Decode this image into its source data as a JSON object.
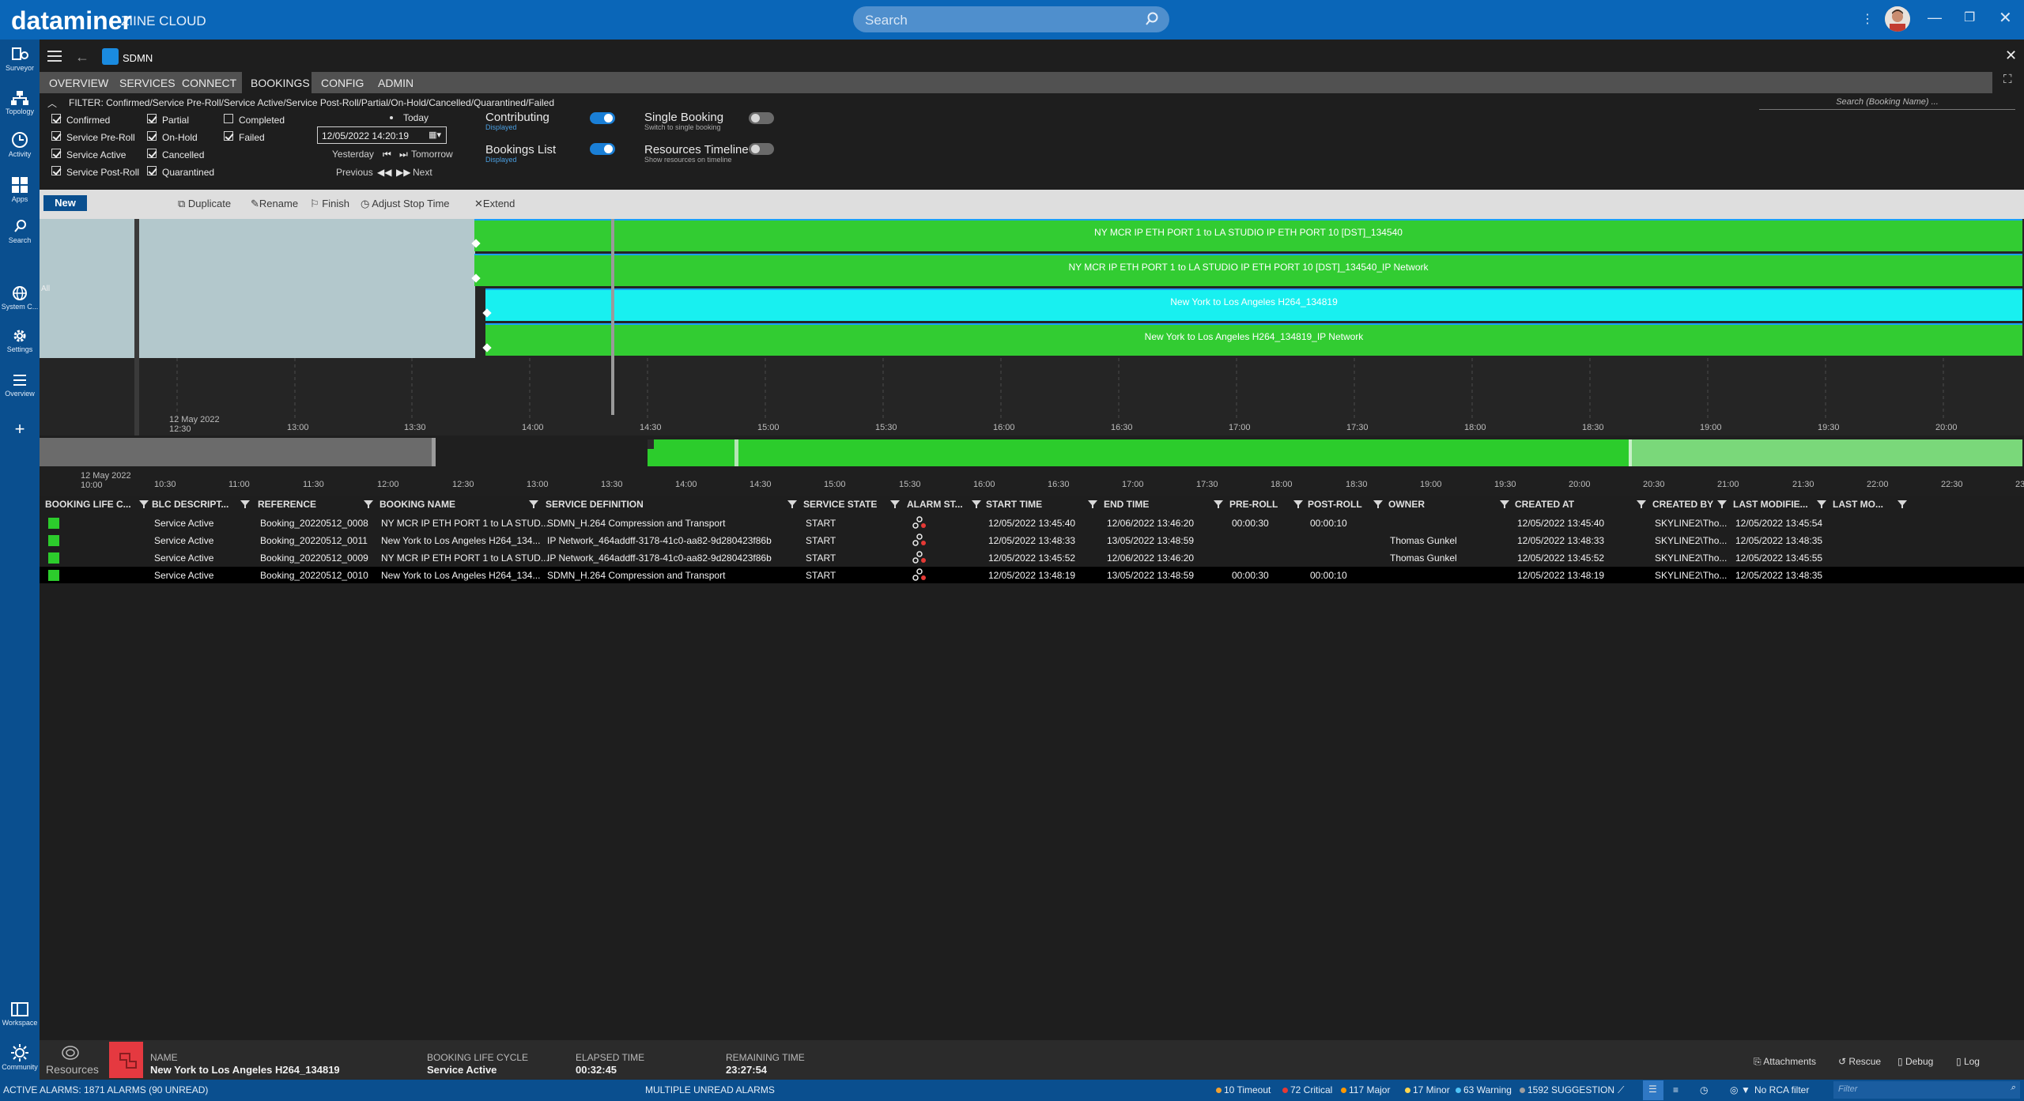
{
  "app": {
    "brand": "dataminer",
    "cluster": "ZIINE CLOUD",
    "search_placeholder": "Search"
  },
  "nav": [
    {
      "label": "Surveyor",
      "icon": "surveyor-icon"
    },
    {
      "label": "Topology",
      "icon": "topology-icon"
    },
    {
      "label": "Activity",
      "icon": "activity-icon"
    },
    {
      "label": "Apps",
      "icon": "apps-icon"
    },
    {
      "label": "Search",
      "icon": "search-icon"
    },
    {
      "label": "System C...",
      "icon": "globe-icon"
    },
    {
      "label": "Settings",
      "icon": "gear-icon"
    },
    {
      "label": "Overview",
      "icon": "list-icon"
    },
    {
      "label": "Workspace",
      "icon": "workspace-icon"
    },
    {
      "label": "Community",
      "icon": "community-icon"
    }
  ],
  "card": {
    "title": "SDMN"
  },
  "tabs": [
    "OVERVIEW",
    "SERVICES",
    "CONNECT",
    "BOOKINGS",
    "CONFIG",
    "ADMIN"
  ],
  "active_tab": "BOOKINGS",
  "filter": {
    "text": "FILTER: Confirmed/Service Pre-Roll/Service Active/Service Post-Roll/Partial/On-Hold/Cancelled/Quarantined/Failed",
    "search_placeholder": "Search (Booking Name) ...",
    "checkboxes": [
      {
        "label": "Confirmed",
        "checked": true
      },
      {
        "label": "Service Pre-Roll",
        "checked": true
      },
      {
        "label": "Service Active",
        "checked": true
      },
      {
        "label": "Service Post-Roll",
        "checked": true
      },
      {
        "label": "Partial",
        "checked": true
      },
      {
        "label": "On-Hold",
        "checked": true
      },
      {
        "label": "Cancelled",
        "checked": true
      },
      {
        "label": "Quarantined",
        "checked": true
      },
      {
        "label": "Completed",
        "checked": false
      },
      {
        "label": "Failed",
        "checked": true
      }
    ],
    "today": "Today",
    "date": "12/05/2022 14:20:19",
    "yesterday": "Yesterday",
    "tomorrow": "Tomorrow",
    "previous": "Previous",
    "next": "Next",
    "toggles": [
      {
        "label": "Contributing",
        "sub": "Displayed",
        "on": true
      },
      {
        "label": "Bookings List",
        "sub": "Displayed",
        "on": true
      },
      {
        "label": "Single Booking",
        "sub": "Switch to single booking",
        "on": false
      },
      {
        "label": "Resources Timeline",
        "sub": "Show resources on timeline",
        "on": false
      }
    ]
  },
  "actions": {
    "new": "New",
    "duplicate": "Duplicate",
    "rename": "Rename",
    "finish": "Finish",
    "adjust": "Adjust Stop Time",
    "extend": "Extend"
  },
  "timeline": {
    "all_label": "All",
    "bars": [
      {
        "label": "NY MCR IP ETH PORT 1 to LA STUDIO  IP ETH PORT 10 [DST]_134540",
        "color": "#32cc32"
      },
      {
        "label": "NY MCR IP ETH PORT 1 to LA STUDIO  IP ETH PORT 10 [DST]_134540_IP Network",
        "color": "#32cc32"
      },
      {
        "label": "New York to Los Angeles H264_134819",
        "color": "#18f0f0"
      },
      {
        "label": "New York to Los Angeles H264_134819_IP Network",
        "color": "#32cc32"
      }
    ],
    "date_label": "12 May 2022",
    "first_tick": "12:30",
    "ticks": [
      "13:00",
      "13:30",
      "14:00",
      "14:30",
      "15:00",
      "15:30",
      "16:00",
      "16:30",
      "17:00",
      "17:30",
      "18:00",
      "18:30",
      "19:00",
      "19:30",
      "20:00"
    ],
    "overview_date": "12 May 2022",
    "overview_first": "10:00",
    "overview_ticks": [
      "10:30",
      "11:00",
      "11:30",
      "12:00",
      "12:30",
      "13:00",
      "13:30",
      "14:00",
      "14:30",
      "15:00",
      "15:30",
      "16:00",
      "16:30",
      "17:00",
      "17:30",
      "18:00",
      "18:30",
      "19:00",
      "19:30",
      "20:00",
      "20:30",
      "21:00",
      "21:30",
      "22:00",
      "22:30",
      "23"
    ]
  },
  "table": {
    "columns": [
      "BOOKING LIFE C...",
      "BLC DESCRIPT...",
      "REFERENCE",
      "BOOKING NAME",
      "SERVICE DEFINITION",
      "SERVICE STATE",
      "ALARM ST...",
      "START TIME",
      "END TIME",
      "PRE-ROLL",
      "POST-ROLL",
      "OWNER",
      "CREATED AT",
      "CREATED BY",
      "LAST MODIFIE...",
      "LAST MO..."
    ],
    "rows": [
      {
        "blc": "Service Active",
        "ref": "Booking_20220512_0008",
        "name": "NY MCR IP ETH PORT 1 to LA STUD...",
        "svc": "SDMN_H.264 Compression and Transport",
        "state": "START",
        "start": "12/05/2022 13:45:40",
        "end": "12/06/2022 13:46:20",
        "pre": "00:00:30",
        "post": "00:00:10",
        "owner": "",
        "created": "12/05/2022 13:45:40",
        "by": "SKYLINE2\\Tho...",
        "mod": "12/05/2022 13:45:54"
      },
      {
        "blc": "Service Active",
        "ref": "Booking_20220512_0011",
        "name": "New York to Los Angeles H264_134...",
        "svc": "IP Network_464addff-3178-41c0-aa82-9d280423f86b",
        "state": "START",
        "start": "12/05/2022 13:48:33",
        "end": "13/05/2022 13:48:59",
        "pre": "",
        "post": "",
        "owner": "Thomas Gunkel",
        "created": "12/05/2022 13:48:33",
        "by": "SKYLINE2\\Tho...",
        "mod": "12/05/2022 13:48:35"
      },
      {
        "blc": "Service Active",
        "ref": "Booking_20220512_0009",
        "name": "NY MCR IP ETH PORT 1 to LA STUD...",
        "svc": "IP Network_464addff-3178-41c0-aa82-9d280423f86b",
        "state": "START",
        "start": "12/05/2022 13:45:52",
        "end": "12/06/2022 13:46:20",
        "pre": "",
        "post": "",
        "owner": "Thomas Gunkel",
        "created": "12/05/2022 13:45:52",
        "by": "SKYLINE2\\Tho...",
        "mod": "12/05/2022 13:45:55"
      },
      {
        "blc": "Service Active",
        "ref": "Booking_20220512_0010",
        "name": "New York to Los Angeles H264_134...",
        "svc": "SDMN_H.264 Compression and Transport",
        "state": "START",
        "start": "12/05/2022 13:48:19",
        "end": "13/05/2022 13:48:59",
        "pre": "00:00:30",
        "post": "00:00:10",
        "owner": "",
        "created": "12/05/2022 13:48:19",
        "by": "SKYLINE2\\Tho...",
        "mod": "12/05/2022 13:48:35"
      }
    ]
  },
  "details": {
    "resources": "Resources",
    "name_label": "NAME",
    "name": "New York to Los Angeles H264_134819",
    "blc_label": "BOOKING LIFE CYCLE",
    "blc": "Service Active",
    "elapsed_label": "ELAPSED TIME",
    "elapsed": "00:32:45",
    "remaining_label": "REMAINING TIME",
    "remaining": "23:27:54",
    "attachments": "Attachments",
    "rescue": "Rescue",
    "debug": "Debug",
    "log": "Log"
  },
  "status": {
    "active_alarms": "ACTIVE ALARMS: 1871 ALARMS (90 UNREAD)",
    "unread": "MULTIPLE UNREAD ALARMS",
    "timeout": "10 Timeout",
    "critical": "72 Critical",
    "major": "117 Major",
    "minor": "17 Minor",
    "warning": "63 Warning",
    "suggestion": "1592 SUGGESTION",
    "rca": "No RCA filter",
    "filter_placeholder": "Filter",
    "colors": {
      "timeout": "#f0a030",
      "critical": "#e53935",
      "major": "#ff9800",
      "minor": "#ffd54f",
      "warning": "#4fc3f7",
      "suggestion": "#9e9e9e"
    }
  }
}
